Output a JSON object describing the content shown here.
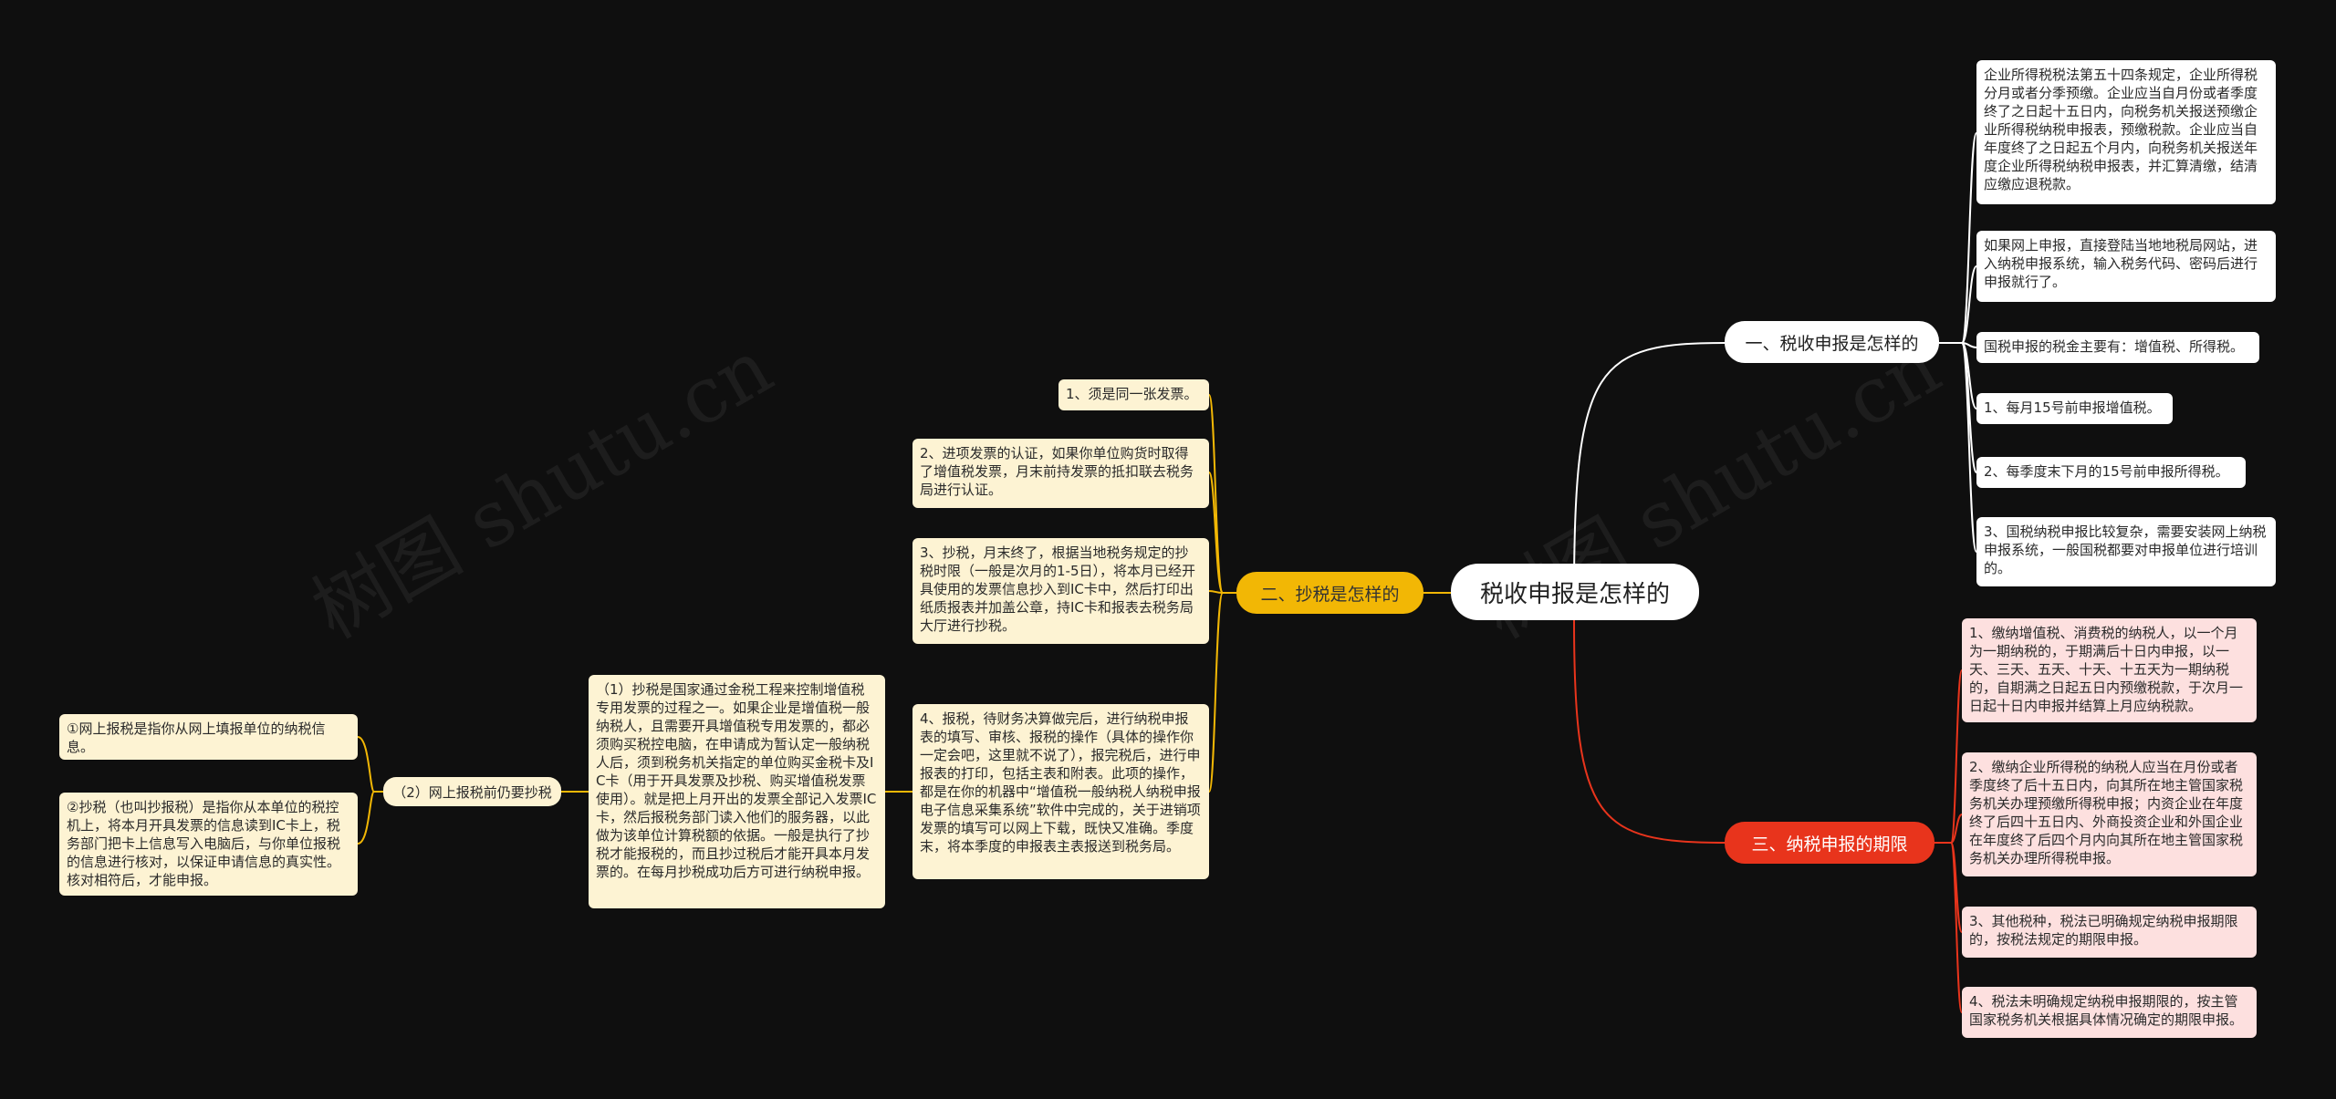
{
  "root": {
    "title": "税收申报是怎样的"
  },
  "branches": [
    {
      "label": "一、税收申报是怎样的",
      "color": "#ffffff",
      "leaves": [
        "企业所得税税法第五十四条规定，企业所得税分月或者分季预缴。企业应当自月份或者季度终了之日起十五日内，向税务机关报送预缴企业所得税纳税申报表，预缴税款。企业应当自年度终了之日起五个月内，向税务机关报送年度企业所得税纳税申报表，并汇算清缴，结清应缴应退税款。",
        "如果网上申报，直接登陆当地地税局网站，进入纳税申报系统，输入税务代码、密码后进行申报就行了。",
        "国税申报的税金主要有：增值税、所得税。",
        "1、每月15号前申报增值税。",
        "2、每季度末下月的15号前申报所得税。",
        "3、国税纳税申报比较复杂，需要安装网上纳税申报系统，一般国税都要对申报单位进行培训的。"
      ]
    },
    {
      "label": "二、抄税是怎样的",
      "color": "#f2b705",
      "leaves": [
        "1、须是同一张发票。",
        "2、进项发票的认证，如果你单位购货时取得了增值税发票，月末前持发票的抵扣联去税务局进行认证。",
        "3、抄税，月末终了，根据当地税务规定的抄税时限（一般是次月的1-5日），将本月已经开具使用的发票信息抄入到IC卡中，然后打印出纸质报表并加盖公章，持IC卡和报表去税务局大厅进行抄税。",
        "4、报税，待财务决算做完后，进行纳税申报表的填写、审核、报税的操作（具体的操作你一定会吧，这里就不说了），报完税后，进行申报表的打印，包括主表和附表。此项的操作，都是在你的机器中“增值税一般纳税人纳税申报电子信息采集系统”软件中完成的，关于进销项发票的填写可以网上下载，既快又准确。季度末，将本季度的申报表主表报送到税务局。"
      ],
      "extra": {
        "detail": "（1）抄税是国家通过金税工程来控制增值税专用发票的过程之一。如果企业是增值税一般纳税人，且需要开具增值税专用发票的，都必须购买税控电脑，在申请成为暂认定一般纳税人后，须到税务机关指定的单位购买金税卡及IC卡（用于开具发票及抄税、购买增值税发票使用）。就是把上月开出的发票全部记入发票IC卡，然后报税务部门读入他们的服务器，以此做为该单位计算税额的依据。一般是执行了抄税才能报税的，而且抄过税后才能开具本月发票的。在每月抄税成功后方可进行纳税申报。",
        "sub": "（2）网上报税前仍要抄税",
        "sub_leaves": [
          "①网上报税是指你从网上填报单位的纳税信息。",
          "②抄税（也叫抄报税）是指你从本单位的税控机上，将本月开具发票的信息读到IC卡上，税务部门把卡上信息写入电脑后，与你单位报税的信息进行核对，以保证申请信息的真实性。核对相符后，才能申报。"
        ]
      }
    },
    {
      "label": "三、纳税申报的期限",
      "color": "#e8341c",
      "leaves": [
        "1、缴纳增值税、消费税的纳税人，以一个月为一期纳税的，于期满后十日内申报，以一天、三天、五天、十天、十五天为一期纳税的，自期满之日起五日内预缴税款，于次月一日起十日内申报并结算上月应纳税款。",
        "2、缴纳企业所得税的纳税人应当在月份或者季度终了后十五日内，向其所在地主管国家税务机关办理预缴所得税申报；内资企业在年度终了后四十五日内、外商投资企业和外国企业在年度终了后四个月内向其所在地主管国家税务机关办理所得税申报。",
        "3、其他税种，税法已明确规定纳税申报期限的，按税法规定的期限申报。",
        "4、税法未明确规定纳税申报期限的，按主管国家税务机关根据具体情况确定的期限申报。"
      ]
    }
  ],
  "watermark": "树图 shutu.cn"
}
